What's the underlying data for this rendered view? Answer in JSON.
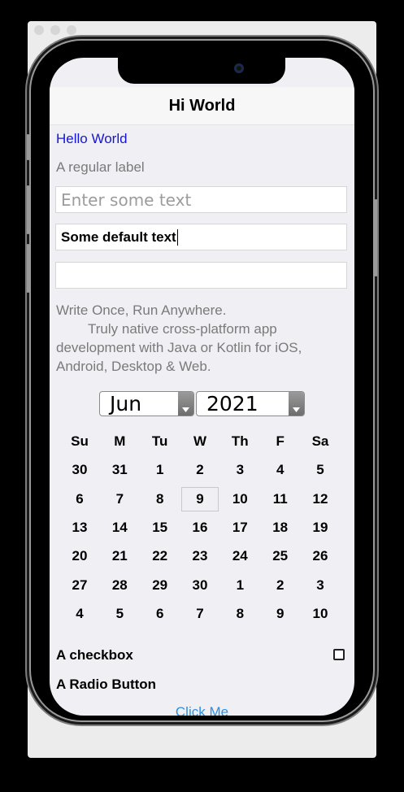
{
  "window": {
    "controls": [
      "close",
      "minimize",
      "zoom"
    ]
  },
  "navbar": {
    "title": "Hi World"
  },
  "form": {
    "hello_label": "Hello World",
    "regular_label": "A regular label",
    "field1_placeholder": "Enter some text",
    "field2_value": "Some default text",
    "field3_value": "",
    "paragraph_line1": "Write Once, Run Anywhere.",
    "paragraph_rest": "Truly native cross-platform app development with Java or Kotlin for iOS, Android, Desktop & Web."
  },
  "calendar": {
    "month": "Jun",
    "year": "2021",
    "weekdays": [
      "Su",
      "M",
      "Tu",
      "W",
      "Th",
      "F",
      "Sa"
    ],
    "weeks": [
      [
        "30",
        "31",
        "1",
        "2",
        "3",
        "4",
        "5"
      ],
      [
        "6",
        "7",
        "8",
        "9",
        "10",
        "11",
        "12"
      ],
      [
        "13",
        "14",
        "15",
        "16",
        "17",
        "18",
        "19"
      ],
      [
        "20",
        "21",
        "22",
        "23",
        "24",
        "25",
        "26"
      ],
      [
        "27",
        "28",
        "29",
        "30",
        "1",
        "2",
        "3"
      ],
      [
        "4",
        "5",
        "6",
        "7",
        "8",
        "9",
        "10"
      ]
    ],
    "selected_day": "9"
  },
  "controls": {
    "checkbox_label": "A checkbox",
    "checkbox_checked": false,
    "radio_label": "A Radio Button",
    "button_label": "Click Me"
  },
  "colors": {
    "link_blue": "#1515d9",
    "button_blue": "#2c8fe6",
    "label_gray": "#7a7a7a",
    "screen_bg": "#f0f0f4"
  }
}
